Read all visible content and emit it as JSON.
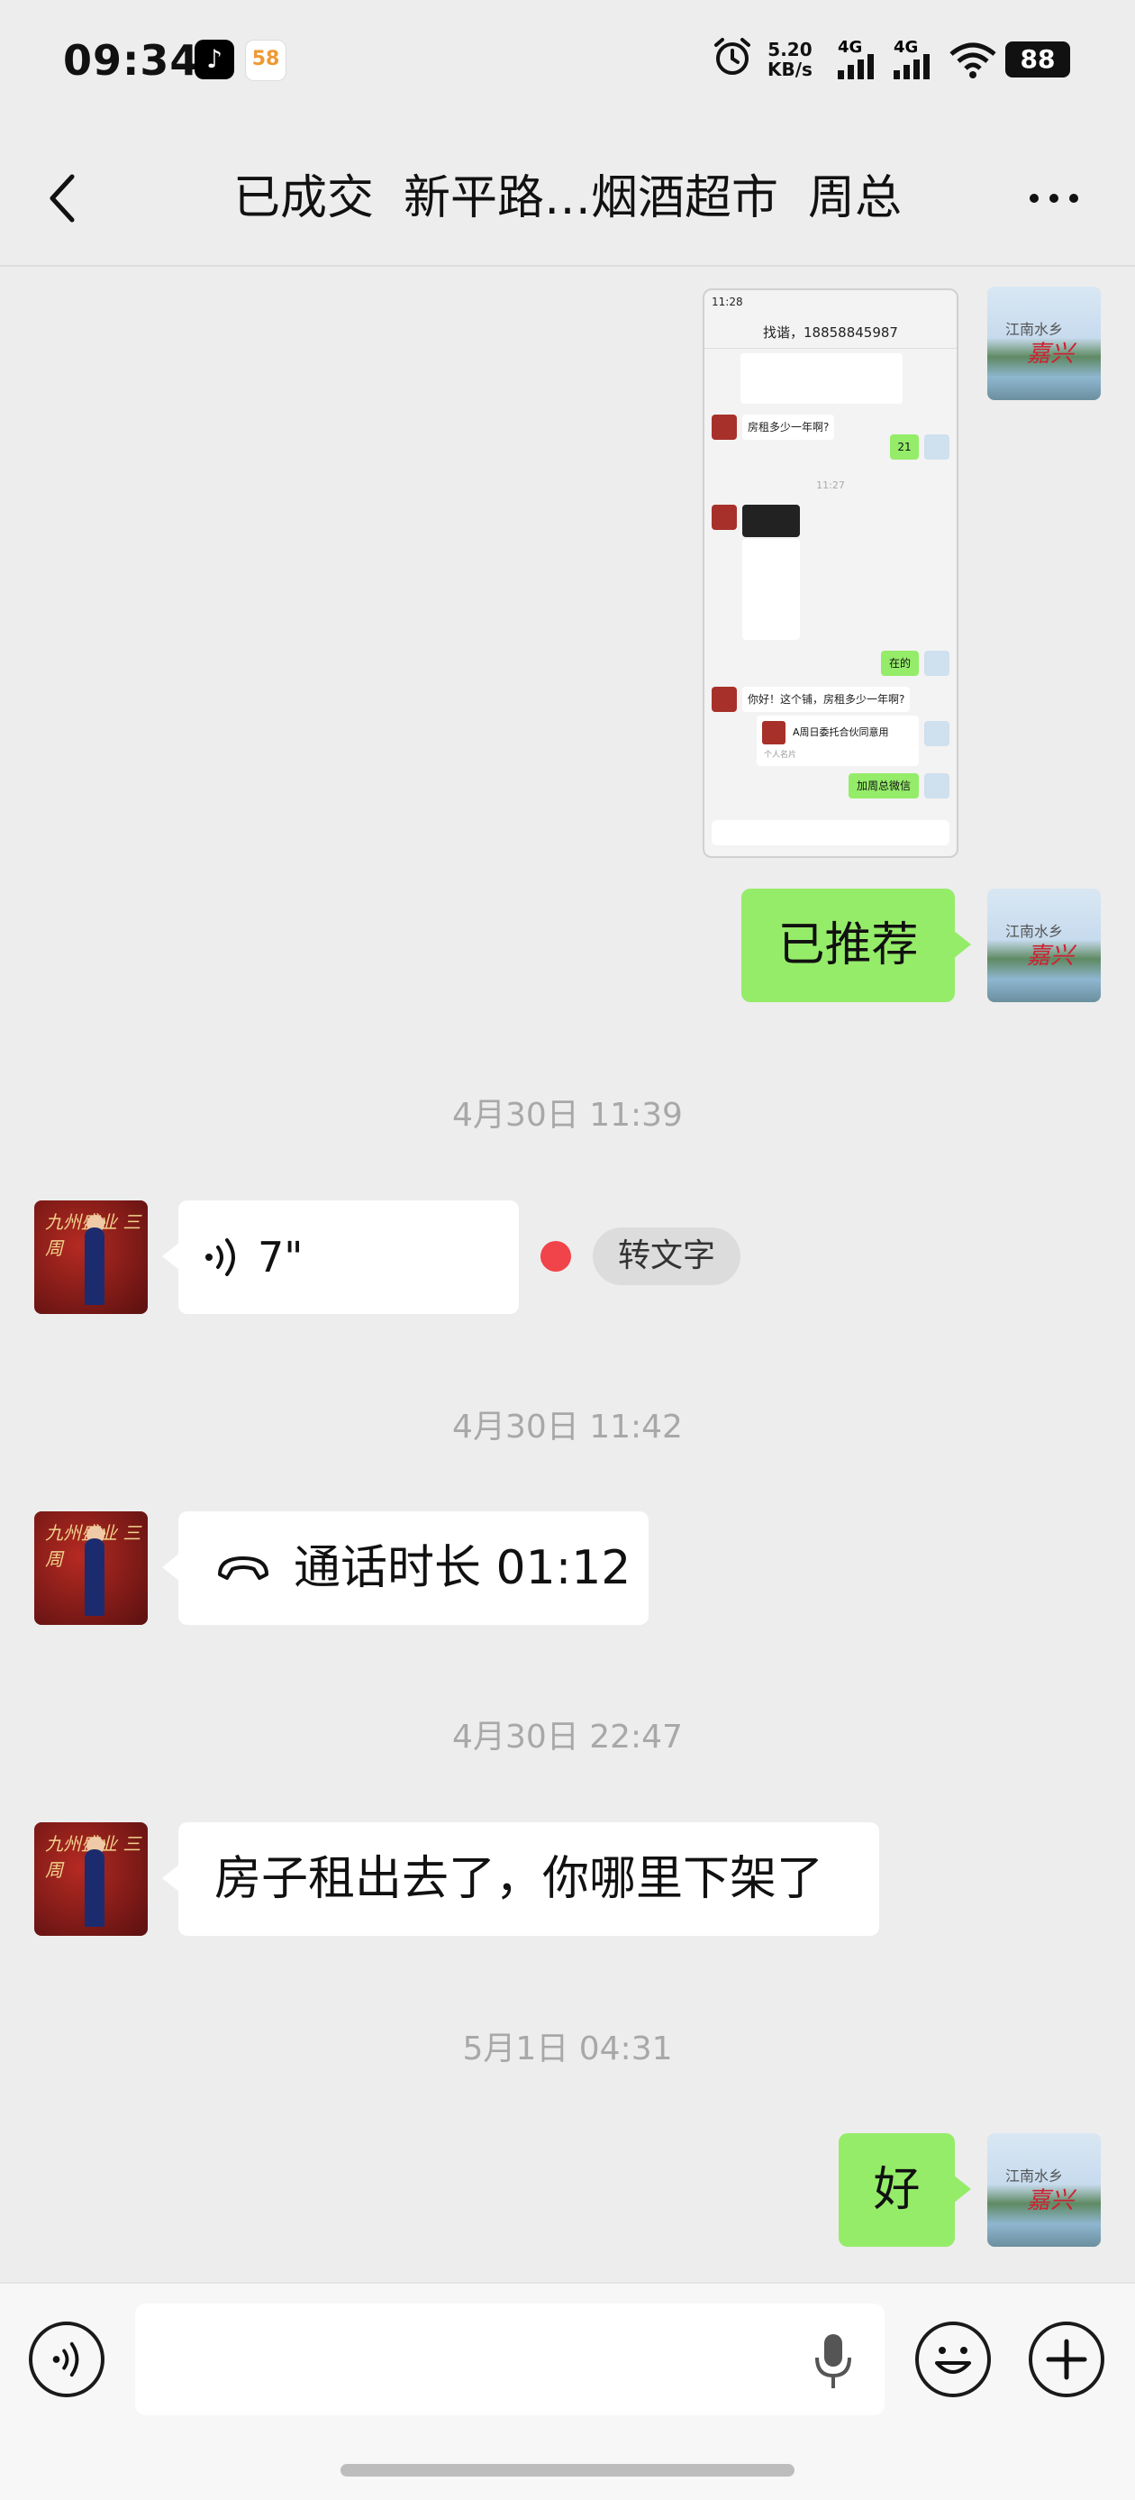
{
  "status_bar": {
    "time": "09:34",
    "app_icons": [
      "tiktok-icon",
      "58-app-icon"
    ],
    "app_58_label": "58",
    "net_speed": "5.20",
    "net_speed_unit": "KB/s",
    "signal_1": "4G",
    "signal_2": "4G",
    "battery": "88"
  },
  "header": {
    "back_icon": "chevron-left-icon",
    "title": "已成交  新平路…烟酒超市  周总",
    "more_icon": "more-dots-icon"
  },
  "messages": [
    {
      "type": "image",
      "sender": "me",
      "thumbnail": {
        "status_time": "11:28",
        "chat_title": "找谐，18858845987",
        "q1": "房租多少一年啊?",
        "reply_21": "21",
        "time": "11:27",
        "reply_zai": "在的",
        "q2": "你好！这个铺，房租多少一年啊?",
        "card": "A周日委托合伙同意用",
        "card_sub": "个人名片",
        "reply_add": "加周总微信"
      }
    },
    {
      "type": "text",
      "sender": "me",
      "text": "已推荐"
    },
    {
      "type": "timestamp",
      "text": "4月30日 11:39"
    },
    {
      "type": "voice",
      "sender": "other",
      "duration": "7\"",
      "unread_dot_color": "#f0434a",
      "action": "转文字"
    },
    {
      "type": "timestamp",
      "text": "4月30日 11:42"
    },
    {
      "type": "call",
      "sender": "other",
      "text": "通话时长 01:12"
    },
    {
      "type": "timestamp",
      "text": "4月30日 22:47"
    },
    {
      "type": "text",
      "sender": "other",
      "text": "房子租出去了，你哪里下架了"
    },
    {
      "type": "timestamp",
      "text": "5月1日 04:31"
    },
    {
      "type": "text",
      "sender": "me",
      "text": "好"
    }
  ],
  "avatars": {
    "me_caption_1": "江南水乡",
    "me_caption_2": "嘉兴",
    "other_caption": "九州盛业 三周"
  },
  "input_bar": {
    "voice_toggle_icon": "voice-mode-icon",
    "mic_icon": "microphone-icon",
    "emoji_icon": "emoji-icon",
    "plus_icon": "plus-icon",
    "input_value": ""
  },
  "colors": {
    "my_bubble": "#95ec69",
    "other_bubble": "#ffffff",
    "background": "#ededed"
  }
}
